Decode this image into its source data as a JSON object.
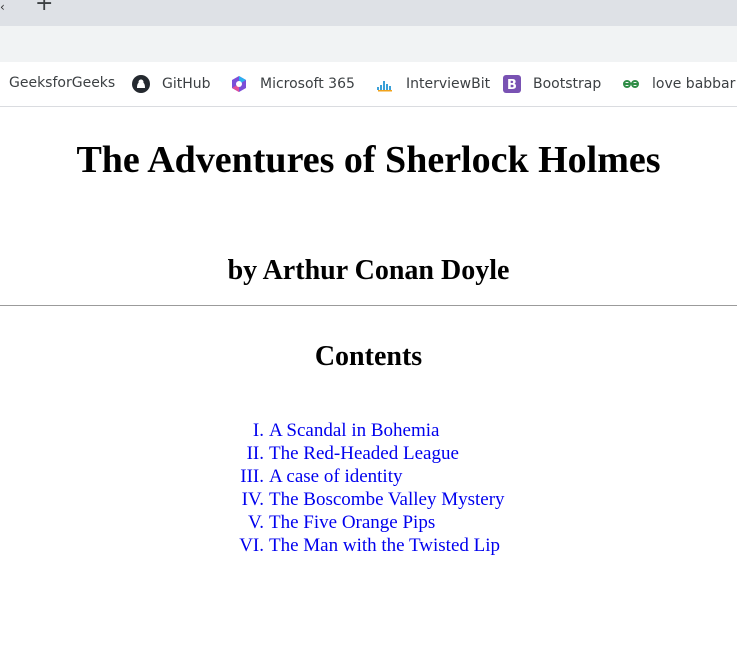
{
  "browser": {
    "bookmarks": [
      {
        "label": "GeeksforGeeks",
        "icon": "geeksforgeeks-icon"
      },
      {
        "label": "GitHub",
        "icon": "github-icon"
      },
      {
        "label": "Microsoft 365",
        "icon": "microsoft365-icon"
      },
      {
        "label": "InterviewBit",
        "icon": "interviewbit-icon"
      },
      {
        "label": "Bootstrap",
        "icon": "bootstrap-icon"
      },
      {
        "label": "love babbar s",
        "icon": "geeksforgeeks-icon"
      }
    ]
  },
  "page": {
    "title": "The Adventures of Sherlock Holmes",
    "author": "by Arthur Conan Doyle",
    "contents_heading": "Contents",
    "toc": [
      {
        "num": "I.",
        "label": "A Scandal in Bohemia"
      },
      {
        "num": "II.",
        "label": "The Red-Headed League"
      },
      {
        "num": "III.",
        "label": "A case of identity"
      },
      {
        "num": "IV.",
        "label": "The Boscombe Valley Mystery"
      },
      {
        "num": "V.",
        "label": "The Five Orange Pips"
      },
      {
        "num": "VI.",
        "label": "The Man with the Twisted Lip"
      }
    ]
  },
  "colors": {
    "link": "#0000ee",
    "chrome": "#dee1e6",
    "bootstrap": "#7952b3",
    "gfg": "#2f8d46"
  }
}
